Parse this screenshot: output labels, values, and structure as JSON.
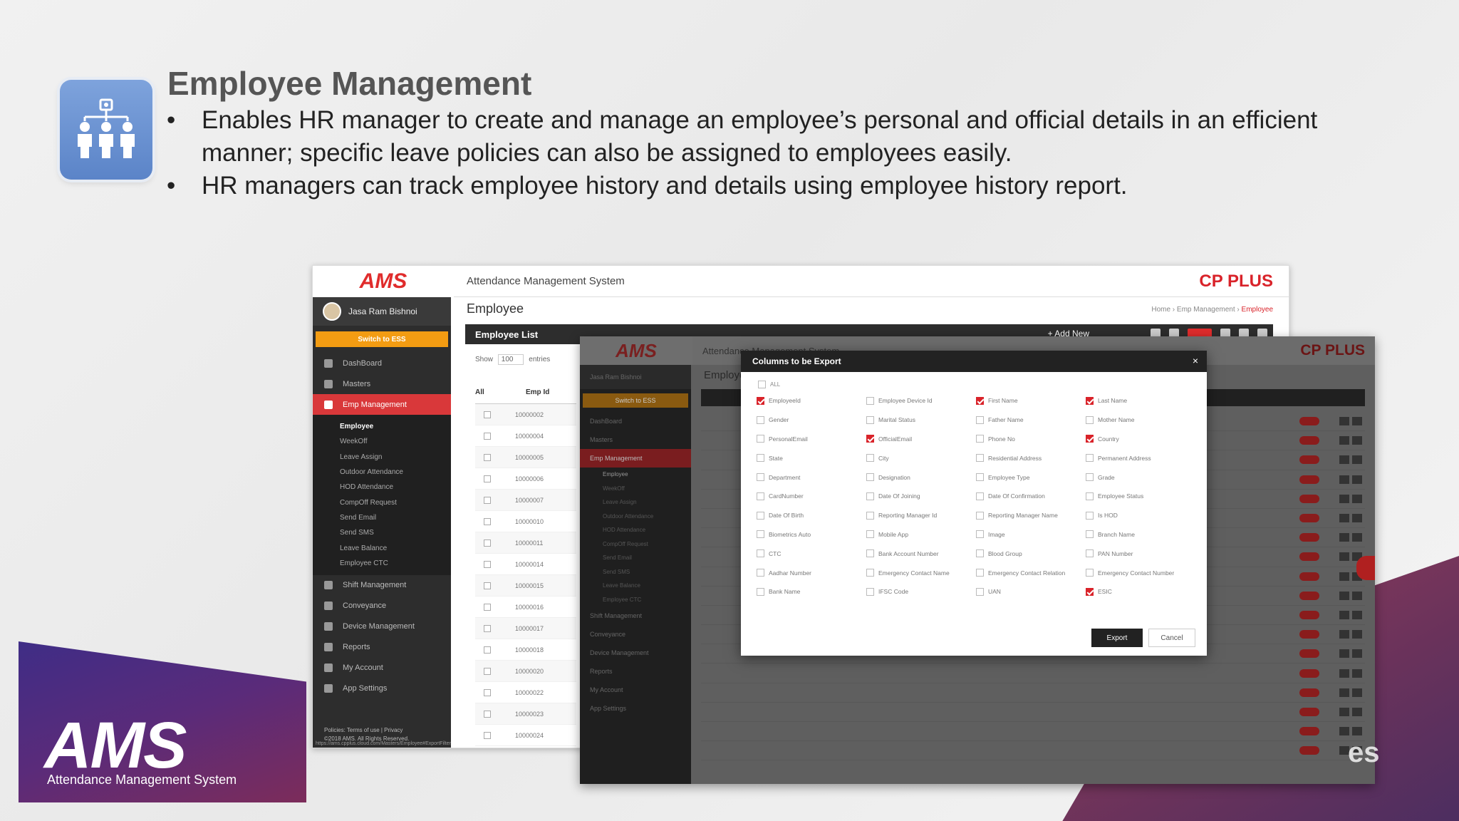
{
  "slide": {
    "title": "Employee Management",
    "bullets": [
      "Enables HR manager to create and manage an employee’s personal and official details in an efficient manner; specific leave policies can also be assigned to employees easily.",
      "HR managers can track employee history and details using employee history report."
    ],
    "logo_text": "AMS",
    "logo_subtitle": "Attendance Management System",
    "corner_text": "es"
  },
  "app": {
    "logo": "AMS",
    "title": "Attendance Management System",
    "brand": "CP PLUS",
    "user": "Jasa Ram Bishnoi",
    "switch_label": "Switch to ESS",
    "page_title": "Employee",
    "breadcrumb": [
      "Home",
      "Emp Management",
      "Employee"
    ],
    "list_title": "Employee List",
    "add_new": "+ Add New",
    "show_label": "Show",
    "show_value": "100",
    "entries_label": "entries",
    "columns": [
      "All",
      "Emp Id"
    ],
    "emp_ids": [
      "10000002",
      "10000004",
      "10000005",
      "10000006",
      "10000007",
      "10000010",
      "10000011",
      "10000014",
      "10000015",
      "10000016",
      "10000017",
      "10000018",
      "10000020",
      "10000022",
      "10000023",
      "10000024"
    ],
    "footer_policies": "Policies: Terms of use | Privacy",
    "footer_copy": "©2018 AMS. All Rights Reserved.",
    "url": "https://ams.cpplus.cloud.com/Masters/Employee#ExportFilter"
  },
  "sidebar": {
    "items": [
      {
        "label": "DashBoard",
        "icon": "dashboard-icon"
      },
      {
        "label": "Masters",
        "icon": "masters-icon"
      },
      {
        "label": "Emp Management",
        "icon": "users-icon",
        "active": true
      },
      {
        "label": "Shift Management",
        "icon": "clock-icon"
      },
      {
        "label": "Conveyance",
        "icon": "car-icon"
      },
      {
        "label": "Device Management",
        "icon": "monitor-icon"
      },
      {
        "label": "Reports",
        "icon": "chart-icon"
      },
      {
        "label": "My Account",
        "icon": "user-icon"
      },
      {
        "label": "App Settings",
        "icon": "gear-icon"
      }
    ],
    "sub_items": [
      "Employee",
      "WeekOff",
      "Leave Assign",
      "Outdoor Attendance",
      "HOD Attendance",
      "CompOff Request",
      "Send Email",
      "Send SMS",
      "Leave Balance",
      "Employee CTC"
    ]
  },
  "modal": {
    "title": "Columns to be Export",
    "all_label": "ALL",
    "export_label": "Export",
    "cancel_label": "Cancel",
    "options": [
      {
        "label": "EmployeeId",
        "checked": true
      },
      {
        "label": "Employee Device Id",
        "checked": false
      },
      {
        "label": "First Name",
        "checked": true
      },
      {
        "label": "Last Name",
        "checked": true
      },
      {
        "label": "Gender",
        "checked": false
      },
      {
        "label": "Marital Status",
        "checked": false
      },
      {
        "label": "Father Name",
        "checked": false
      },
      {
        "label": "Mother Name",
        "checked": false
      },
      {
        "label": "PersonalEmail",
        "checked": false
      },
      {
        "label": "OfficialEmail",
        "checked": true
      },
      {
        "label": "Phone No",
        "checked": false
      },
      {
        "label": "Country",
        "checked": true
      },
      {
        "label": "State",
        "checked": false
      },
      {
        "label": "City",
        "checked": false
      },
      {
        "label": "Residential Address",
        "checked": false
      },
      {
        "label": "Permanent Address",
        "checked": false
      },
      {
        "label": "Department",
        "checked": false
      },
      {
        "label": "Designation",
        "checked": false
      },
      {
        "label": "Employee Type",
        "checked": false
      },
      {
        "label": "Grade",
        "checked": false
      },
      {
        "label": "CardNumber",
        "checked": false
      },
      {
        "label": "Date Of Joining",
        "checked": false
      },
      {
        "label": "Date Of Confirmation",
        "checked": false
      },
      {
        "label": "Employee Status",
        "checked": false
      },
      {
        "label": "Date Of Birth",
        "checked": false
      },
      {
        "label": "Reporting Manager Id",
        "checked": false
      },
      {
        "label": "Reporting Manager Name",
        "checked": false
      },
      {
        "label": "Is HOD",
        "checked": false
      },
      {
        "label": "Biometrics Auto",
        "checked": false
      },
      {
        "label": "Mobile App",
        "checked": false
      },
      {
        "label": "Image",
        "checked": false
      },
      {
        "label": "Branch Name",
        "checked": false
      },
      {
        "label": "CTC",
        "checked": false
      },
      {
        "label": "Bank Account Number",
        "checked": false
      },
      {
        "label": "Blood Group",
        "checked": false
      },
      {
        "label": "PAN Number",
        "checked": false
      },
      {
        "label": "Aadhar Number",
        "checked": false
      },
      {
        "label": "Emergency Contact Name",
        "checked": false
      },
      {
        "label": "Emergency Contact Relation",
        "checked": false
      },
      {
        "label": "Emergency Contact Number",
        "checked": false
      },
      {
        "label": "Bank Name",
        "checked": false
      },
      {
        "label": "IFSC Code",
        "checked": false
      },
      {
        "label": "UAN",
        "checked": false
      },
      {
        "label": "ESIC",
        "checked": true
      }
    ]
  },
  "colors": {
    "accent": "#d9232a",
    "switch": "#f39c12",
    "sidebar": "#2d2d2d"
  }
}
